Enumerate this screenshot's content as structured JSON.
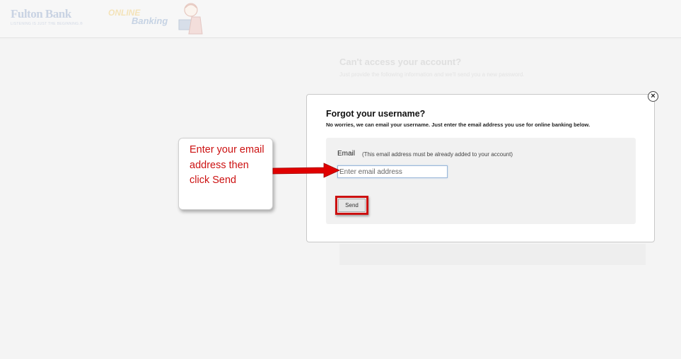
{
  "header": {
    "bank_name": "Fulton Bank",
    "bank_tagline": "LISTENING IS JUST THE BEGINNING.®",
    "online_word": "ONLINE",
    "banking_word": "Banking",
    "mascot_icon": "person-at-laptop-icon"
  },
  "background": {
    "title": "Can't access your account?",
    "subtitle": "Just provide the following information and we'll send you a new password."
  },
  "modal": {
    "title": "Forgot your username?",
    "subtitle": "No worries, we can email your username. Just enter the email address you use for online banking below.",
    "close_icon": "close-circle-icon",
    "close_glyph": "×",
    "email_label": "Email",
    "email_hint": "(This email address must be already added to your account)",
    "email_placeholder": "Enter email address",
    "email_value": "",
    "send_label": "Send"
  },
  "annotation": {
    "callout_text": "Enter your email address then click Send",
    "highlight_color": "#cc1111",
    "arrow_icon": "red-arrow-right-icon"
  }
}
